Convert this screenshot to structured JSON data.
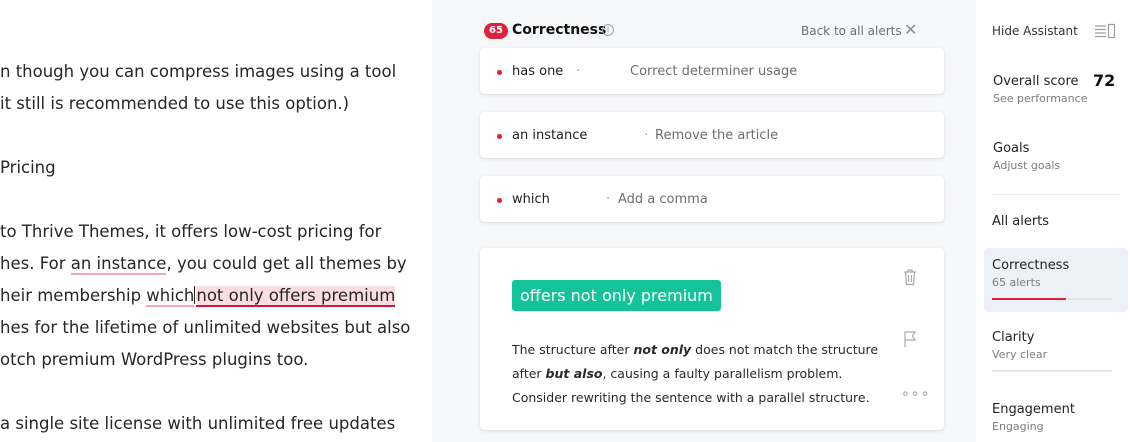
{
  "editor": {
    "lines": [
      {
        "text": "n though you can compress images using a tool"
      },
      {
        "text": "it still is recommended to use this option.)"
      },
      {
        "text": "Pricing"
      },
      {
        "text": "to Thrive Themes, it offers low-cost pricing for"
      },
      {
        "pre": "hes. For ",
        "mark": "an instance",
        "post": ", you could get all themes by"
      },
      {
        "pre": "heir membership ",
        "mark": "which",
        "highlight": "not only offers premium"
      },
      {
        "text": "hes for the lifetime of unlimited websites but also"
      },
      {
        "text": "otch premium WordPress plugins too."
      },
      {
        "text": "a single site license with unlimited free updates"
      }
    ]
  },
  "assistant": {
    "score_badge": "65",
    "title": "Correctness",
    "info_glyph": "i",
    "back_label": "Back to all alerts",
    "close_glyph": "✕",
    "alerts": [
      {
        "term": "has one",
        "sep": "·",
        "desc": "Correct determiner usage"
      },
      {
        "term": "an instance",
        "sep": "·",
        "desc": "Remove the article"
      },
      {
        "term": "which",
        "sep": "·",
        "desc": "Add a comma"
      }
    ],
    "detail": {
      "suggestion": "offers not only premium",
      "explain_1": "The structure after ",
      "explain_b1": "not only",
      "explain_2": " does not match the structure after ",
      "explain_b2": "but also",
      "explain_3": ", causing a faulty parallelism problem. Consider rewriting the sentence with a parallel structure.",
      "more_glyph": "∘∘∘"
    },
    "colors": {
      "accent": "#15c39a",
      "alert": "#e0203d"
    }
  },
  "sidebar": {
    "hide_label": "Hide Assistant",
    "overall_label": "Overall score",
    "overall_value": "72",
    "overall_sub": "See performance",
    "goals_label": "Goals",
    "goals_sub": "Adjust goals",
    "all_alerts": "All alerts",
    "categories": [
      {
        "name": "Correctness",
        "sub": "65 alerts",
        "fill": 0.62,
        "color": "#e0203d",
        "active": true
      },
      {
        "name": "Clarity",
        "sub": "Very clear",
        "fill": 0.0,
        "color": "#4a6ee0",
        "active": false
      },
      {
        "name": "Engagement",
        "sub": "Engaging",
        "fill": 0.0,
        "color": "#15c39a",
        "active": false
      }
    ]
  }
}
